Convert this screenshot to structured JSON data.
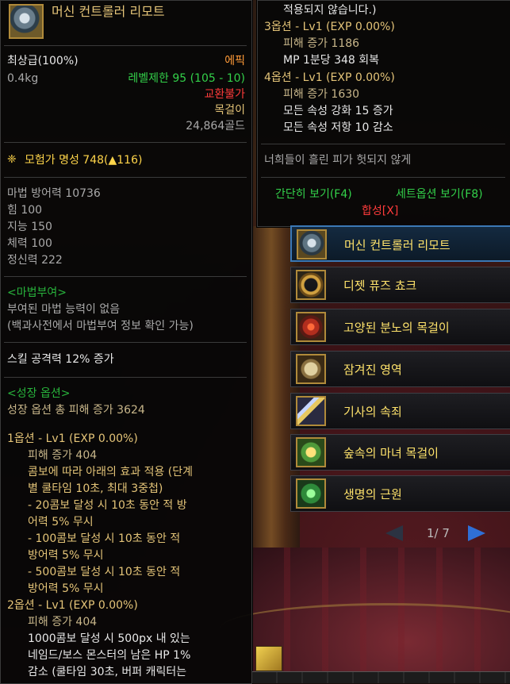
{
  "item": {
    "name": "머신 컨트롤러 리모트",
    "grade": "최상급(100%)",
    "rarity": "에픽",
    "weight": "0.4kg",
    "level_req": "레벨제한 95 (105 - 10)",
    "trade": "교환불가",
    "type": "목걸이",
    "price": "24,864골드",
    "fame": "모험가 명성 748(▲116)",
    "stats": [
      "마법 방어력 10736",
      "힘 100",
      "지능 150",
      "체력 100",
      "정신력 222"
    ],
    "enchant_header": "<마법부여>",
    "enchant_lines": [
      "부여된 마법 능력이 없음",
      "(백과사전에서 마법부여 정보 확인 가능)"
    ],
    "skill_attack": "스킬 공격력 12% 증가",
    "growth_header": "<성장 옵션>",
    "growth_total": "성장 옵션 총 피해 증가 3624",
    "opt1_lines": [
      "1옵션 - Lv1 (EXP 0.00%)",
      "피해 증가 404",
      "콤보에 따라 아래의 효과 적용 (단계",
      "별 쿨타임 10초, 최대 3중첩)",
      "- 20콤보 달성 시 10초 동안 적 방",
      "어력 5% 무시",
      "- 100콤보 달성 시 10초 동안 적",
      "방어력 5% 무시",
      "- 500콤보 달성 시 10초 동안 적",
      "방어력 5% 무시"
    ],
    "opt2_lines": [
      "2옵션 - Lv1 (EXP 0.00%)",
      "피해 증가 404",
      "1000콤보 달성 시 500px 내 있는",
      "네임드/보스 몬스터의 남은 HP 1%",
      "감소 (쿨타임 30초, 버퍼 캐릭터는"
    ]
  },
  "popup": {
    "lines": [
      "적용되지 않습니다.)",
      "3옵션 - Lv1 (EXP 0.00%)",
      "피해 증가 1186",
      "MP 1분당 348 회복",
      "4옵션 - Lv1 (EXP 0.00%)",
      "피해 증가 1630",
      "모든 속성 강화 15 증가",
      "모든 속성 저항 10 감소"
    ],
    "flavor": "너희들이 흘린 피가 헛되지 않게",
    "simple_view": "간단히 보기(F4)",
    "set_option_view": "세트옵션 보기(F8)",
    "combine": "합성[X]"
  },
  "set_list": {
    "items": [
      {
        "label": "머신 컨트롤러 리모트",
        "icon": "remote-icon"
      },
      {
        "label": "디젯 퓨즈 쵸크",
        "icon": "choker-icon"
      },
      {
        "label": "고양된 분노의 목걸이",
        "icon": "necklace-icon"
      },
      {
        "label": "잠겨진 영역",
        "icon": "clock-icon"
      },
      {
        "label": "기사의 속죄",
        "icon": "knight-icon"
      },
      {
        "label": "숲속의 마녀 목걸이",
        "icon": "witch-necklace-icon"
      },
      {
        "label": "생명의 근원",
        "icon": "life-source-icon"
      }
    ],
    "pager": "1/ 7"
  },
  "colors": {
    "epic": "#ff9b38",
    "green": "#33d14a",
    "gold": "#e4c478",
    "red": "#ff3b3b",
    "list_label": "#ffe36b"
  }
}
